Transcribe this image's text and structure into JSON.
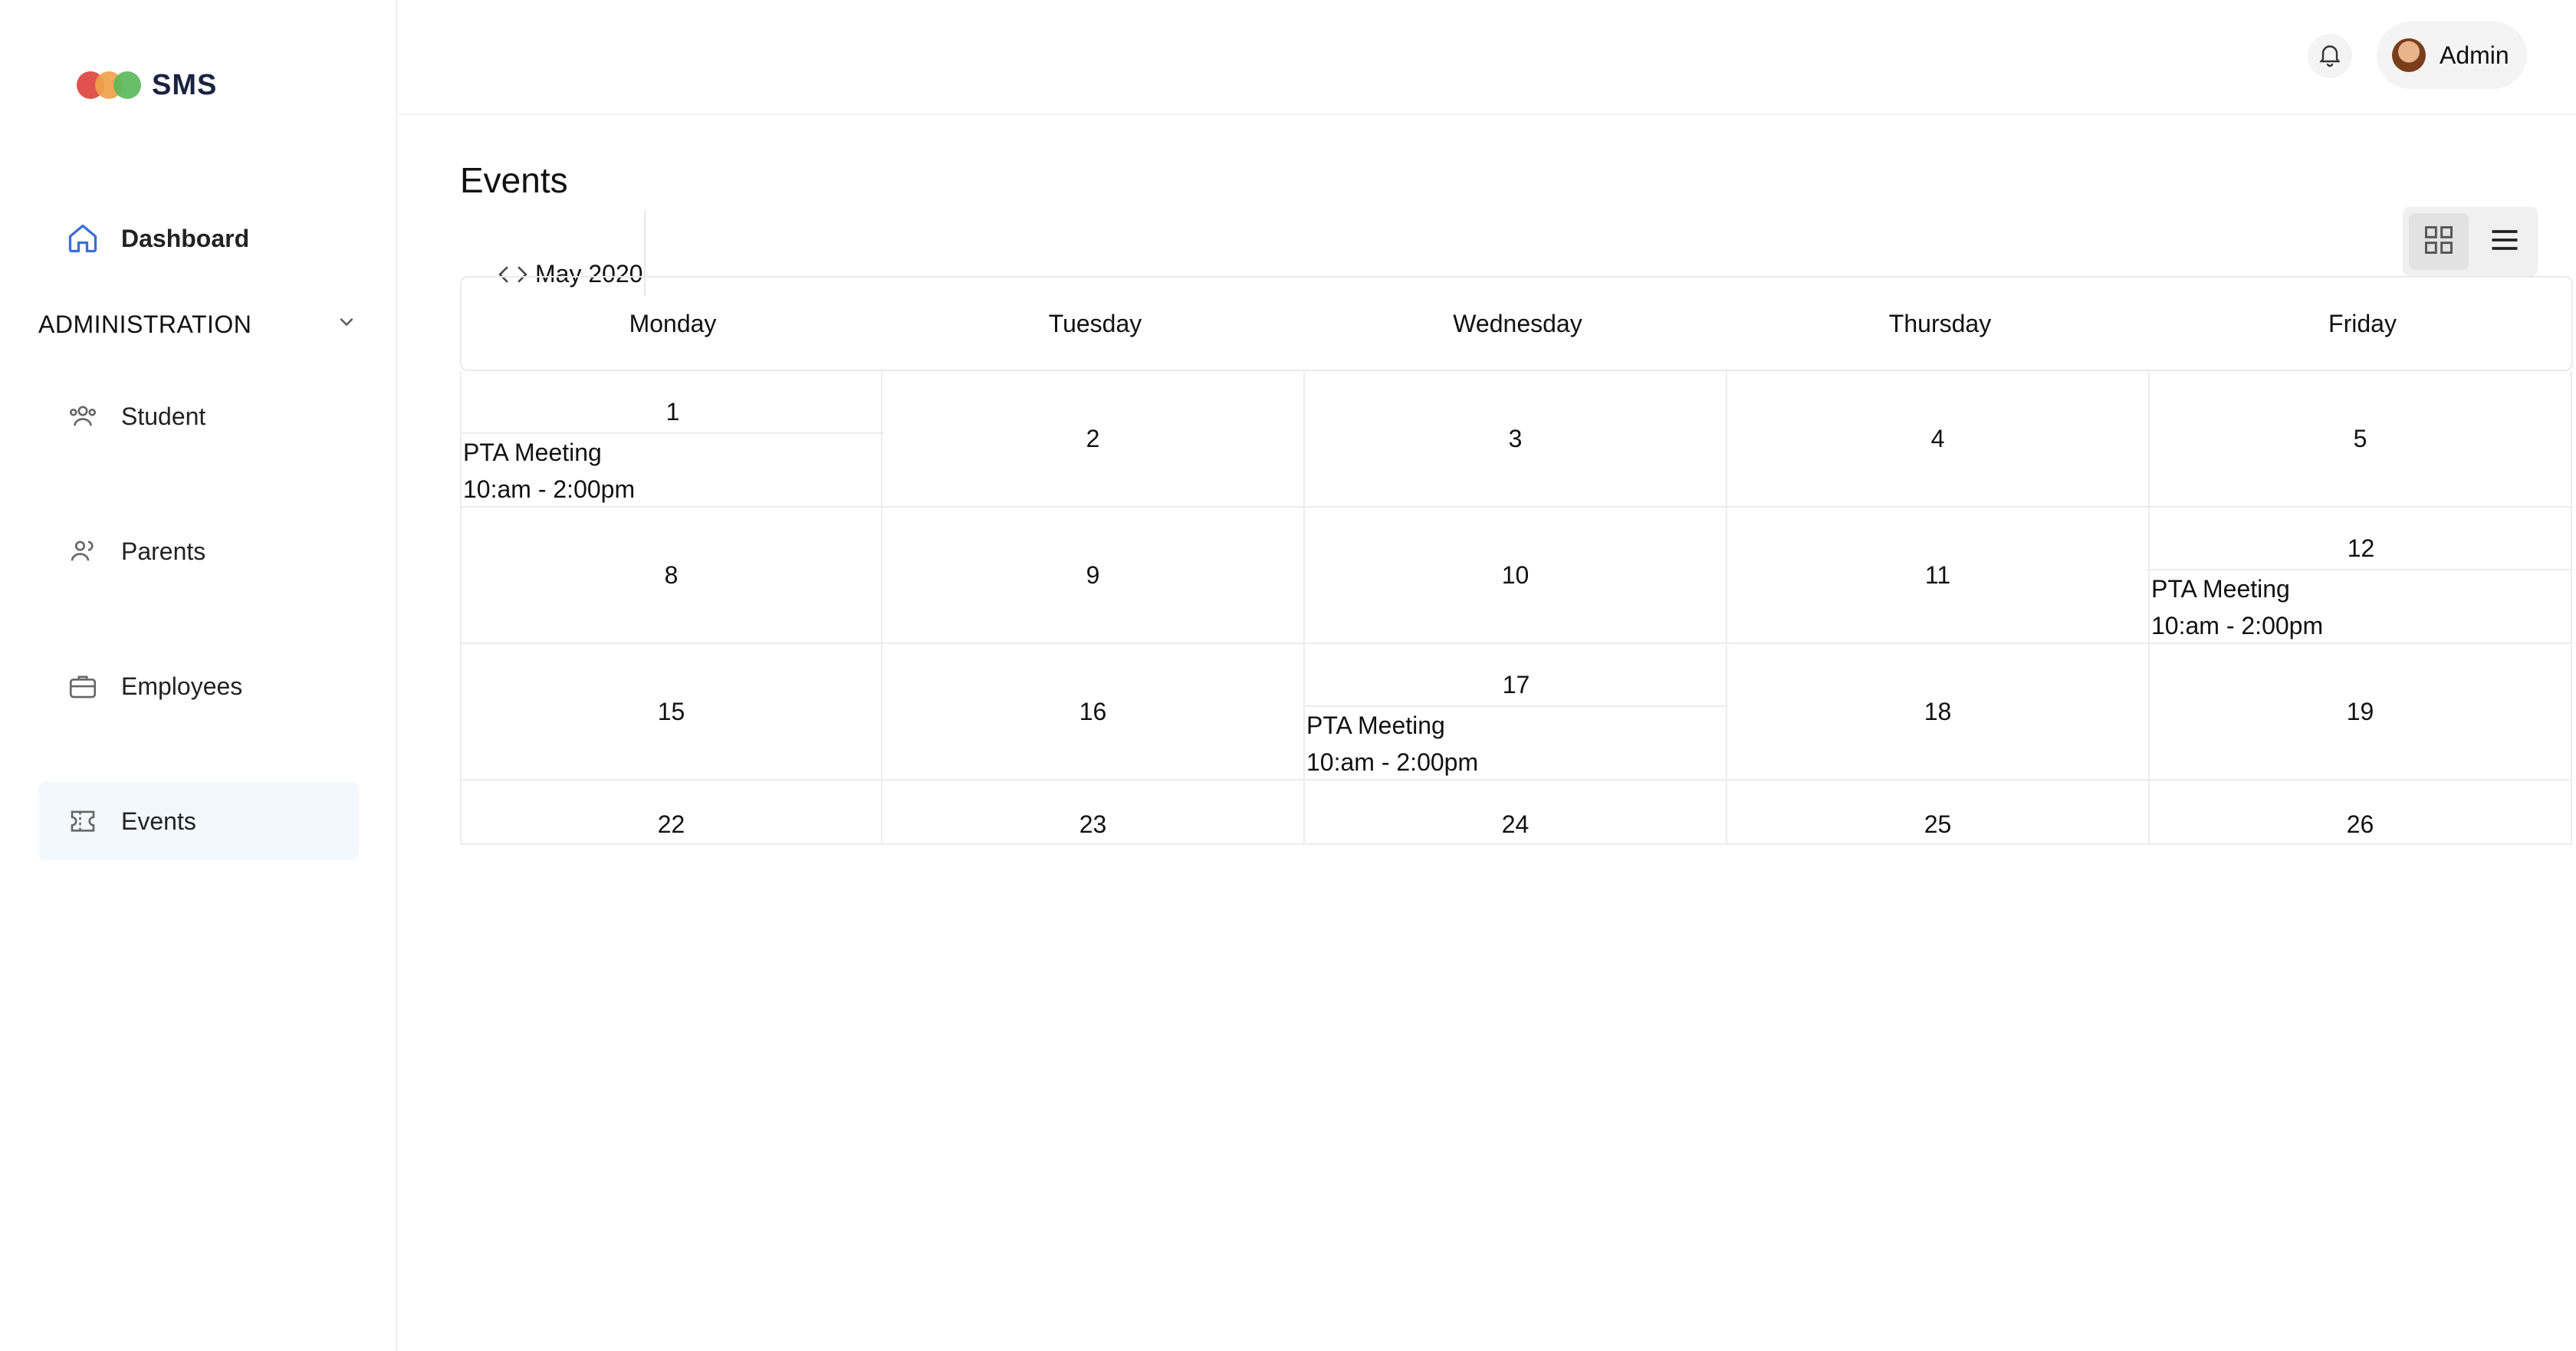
{
  "app": {
    "logo_text": "SMS"
  },
  "sidebar": {
    "dashboard": "Dashboard",
    "section_title": "ADMINISTRATION",
    "items": [
      {
        "label": "Student",
        "icon": "users-icon"
      },
      {
        "label": "Parents",
        "icon": "parents-icon"
      },
      {
        "label": "Employees",
        "icon": "briefcase-icon"
      },
      {
        "label": "Events",
        "icon": "ticket-icon",
        "active": true
      }
    ]
  },
  "topbar": {
    "user_name": "Admin"
  },
  "page": {
    "title": "Events",
    "month_label": "May 2020"
  },
  "calendar": {
    "weekdays": [
      "Monday",
      "Tuesday",
      "Wednesday",
      "Thursday",
      "Friday"
    ],
    "weeks": [
      [
        {
          "day": "1",
          "event": {
            "title": "PTA Meeting",
            "time": "10:am - 2:00pm"
          }
        },
        {
          "day": "2"
        },
        {
          "day": "3"
        },
        {
          "day": "4"
        },
        {
          "day": "5"
        }
      ],
      [
        {
          "day": "8"
        },
        {
          "day": "9"
        },
        {
          "day": "10"
        },
        {
          "day": "11"
        },
        {
          "day": "12",
          "event": {
            "title": "PTA Meeting",
            "time": "10:am - 2:00pm"
          }
        }
      ],
      [
        {
          "day": "15"
        },
        {
          "day": "16"
        },
        {
          "day": "17",
          "event": {
            "title": "PTA Meeting",
            "time": "10:am - 2:00pm"
          }
        },
        {
          "day": "18"
        },
        {
          "day": "19"
        }
      ],
      [
        {
          "day": "22"
        },
        {
          "day": "23"
        },
        {
          "day": "24"
        },
        {
          "day": "25"
        },
        {
          "day": "26"
        }
      ]
    ]
  },
  "colors": {
    "active_bg": "#f3f8fd",
    "accent": "#3b6fd6",
    "logo_red": "#e0524e",
    "logo_orange": "#f0a24b",
    "logo_green": "#5cb85c"
  }
}
